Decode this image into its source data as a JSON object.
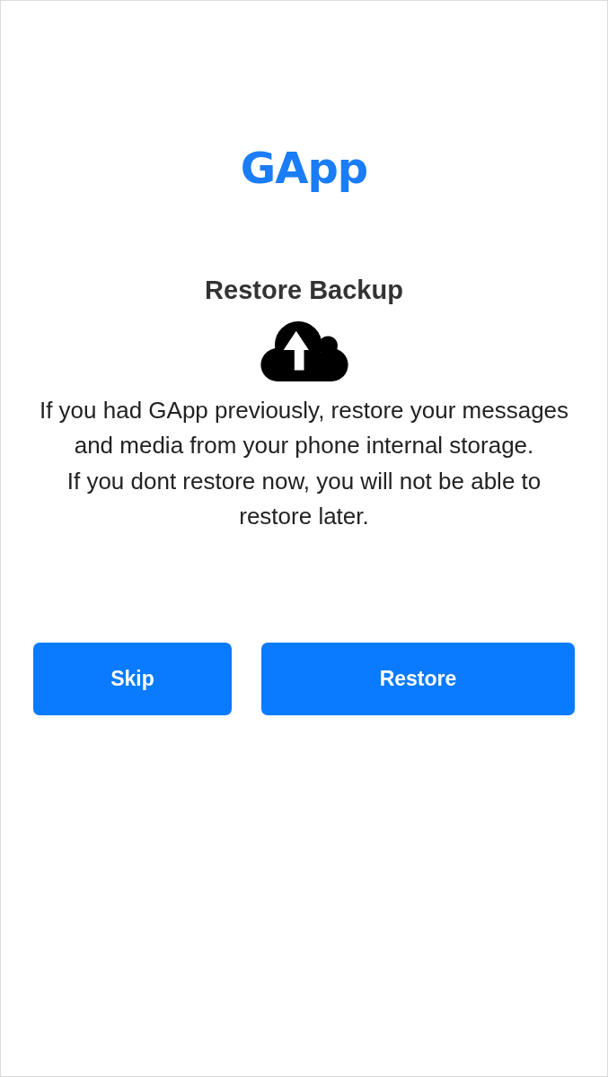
{
  "logo": {
    "text": "GApp"
  },
  "title": "Restore Backup",
  "message": [
    "If you had GApp previously, restore your messages and media from your phone internal storage.",
    "If you dont restore now, you will not be able to restore later."
  ],
  "buttons": [
    {
      "label": "Skip"
    },
    {
      "label": "Restore"
    }
  ]
}
